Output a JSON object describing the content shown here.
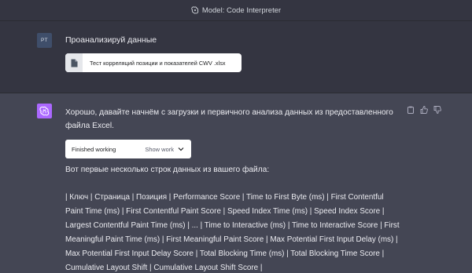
{
  "topbar": {
    "model_label": "Model: Code Interpreter"
  },
  "user": {
    "avatar_initials": "PT",
    "message": "Проанализируй данные",
    "attachment_name": "Тест корреляций позиции и показателей CWV .xlsx"
  },
  "assistant": {
    "reply_text": "Хорошо, давайте начнём с загрузки и первичного анализа данных из предоставленного файла Excel.",
    "working_status": "Finished working",
    "show_work_label": "Show work",
    "intro_text": "Вот первые несколько строк данных из вашего файла:",
    "table_header_text": "| Ключ | Страница | Позиция | Performance Score | Time to First Byte (ms) | First Contentful Paint Time (ms) | First Contentful Paint Score | Speed Index Time (ms) | Speed Index Score | Largest Contentful Paint Time (ms) | ... | Time to Interactive (ms) | Time to Interactive Score | First Meaningful Paint Time (ms) | First Meaningful Paint Score | Max Potential First Input Delay (ms) | Max Potential First Input Delay Score | Total Blocking Time (ms) | Total Blocking Time Score | Cumulative Layout Shift | Cumulative Layout Shift Score |"
  },
  "icons": {
    "model": "openai-logo-icon",
    "file": "document-icon",
    "assistant_avatar": "openai-logo-icon",
    "copy": "clipboard-icon",
    "like": "thumbs-up-icon",
    "dislike": "thumbs-down-icon",
    "chevron": "chevron-down-icon"
  },
  "colors": {
    "page_bg": "#343541",
    "assistant_bg": "#444654",
    "assistant_avatar": "#ab68ff",
    "user_avatar": "#3f4e6a"
  }
}
